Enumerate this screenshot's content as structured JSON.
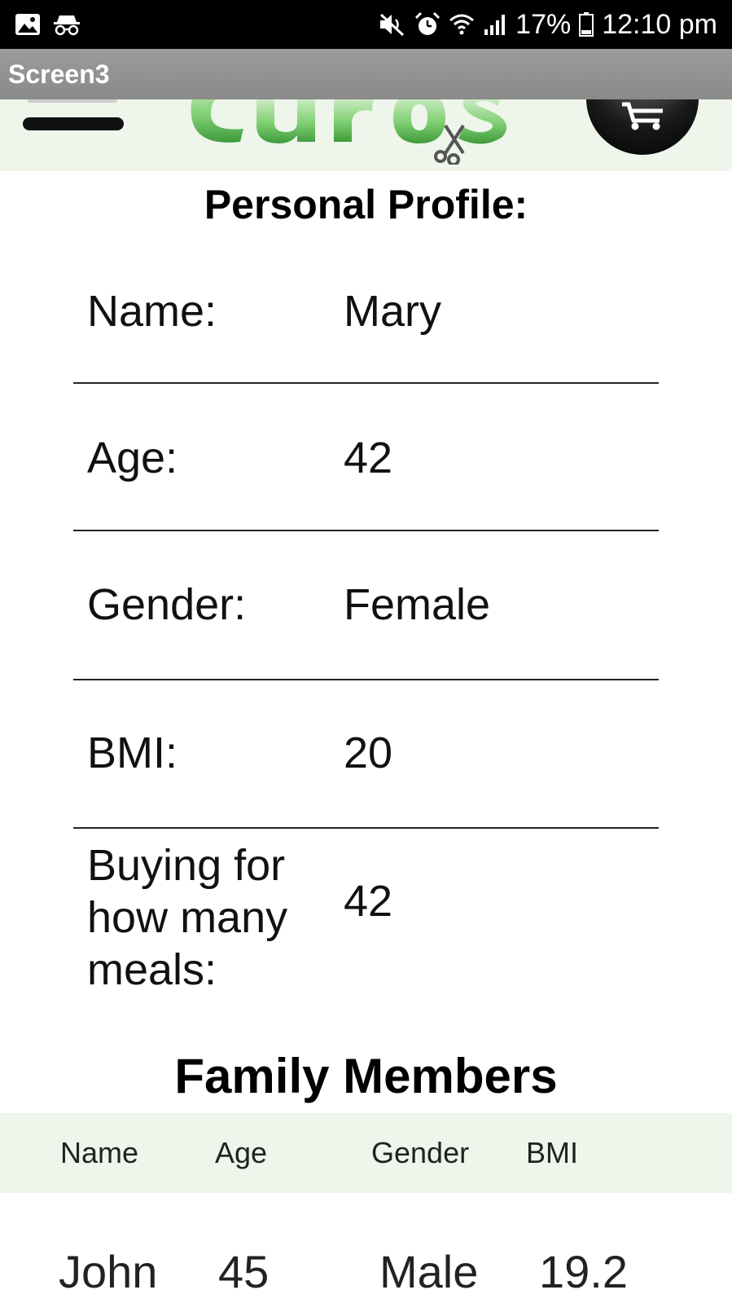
{
  "status_bar": {
    "battery_percent": "17%",
    "time": "12:10 pm",
    "icons": [
      "gallery-icon",
      "incognito-icon",
      "mute-icon",
      "alarm-icon",
      "wifi-icon",
      "signal-icon",
      "battery-icon"
    ]
  },
  "screen": {
    "title": "Screen3"
  },
  "profile": {
    "title": "Personal Profile:",
    "rows": [
      {
        "label": "Name:",
        "value": "Mary"
      },
      {
        "label": "Age:",
        "value": "42"
      },
      {
        "label": "Gender:",
        "value": "Female"
      },
      {
        "label": "BMI:",
        "value": "20"
      },
      {
        "label": "Buying for how many meals:",
        "value": "42"
      }
    ]
  },
  "family": {
    "title": "Family Members",
    "headers": {
      "name": "Name",
      "age": "Age",
      "gender": "Gender",
      "bmi": "BMI"
    },
    "members": [
      {
        "name": "John",
        "age": "45",
        "gender": "Male",
        "bmi": "19.2"
      }
    ]
  },
  "colors": {
    "header_tint": "#eef5ea",
    "title_bar": "#8f8f8f",
    "status_bar": "#000000"
  }
}
